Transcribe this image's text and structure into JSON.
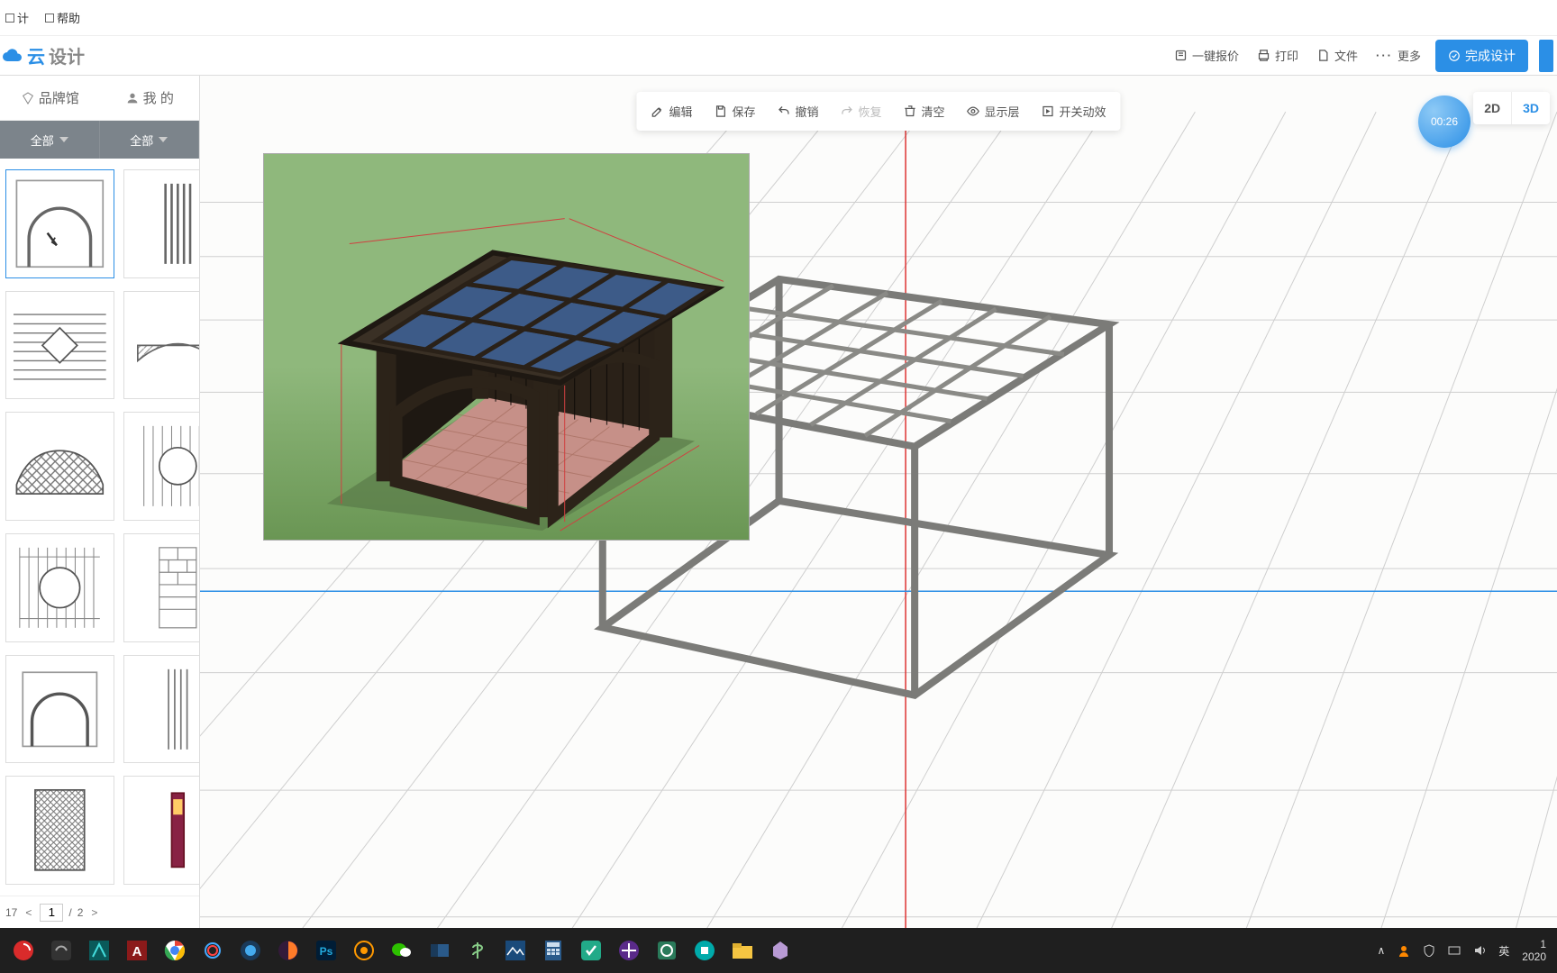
{
  "menubar": {
    "item_design": "计",
    "item_help": "帮助"
  },
  "logo": {
    "char1": "云",
    "char2": "设计"
  },
  "header_actions": {
    "quote": "一键报价",
    "print": "打印",
    "file": "文件",
    "more": "更多",
    "finish": "完成设计"
  },
  "sidebar": {
    "tab_brand": "品牌馆",
    "tab_mine": "我 的",
    "filter_all_1": "全部",
    "filter_all_2": "全部"
  },
  "toolbar": {
    "edit": "编辑",
    "save": "保存",
    "undo": "撤销",
    "redo": "恢复",
    "clear": "清空",
    "layer": "显示层",
    "anim": "开关动效"
  },
  "view": {
    "two_d": "2D",
    "three_d": "3D",
    "timer": "00:26"
  },
  "pagination": {
    "total_label": "17",
    "current": "1",
    "sep": "/",
    "total_pages": "2",
    "prev": "<",
    "next": ">"
  },
  "tray": {
    "ime": "英",
    "year": "2020"
  }
}
